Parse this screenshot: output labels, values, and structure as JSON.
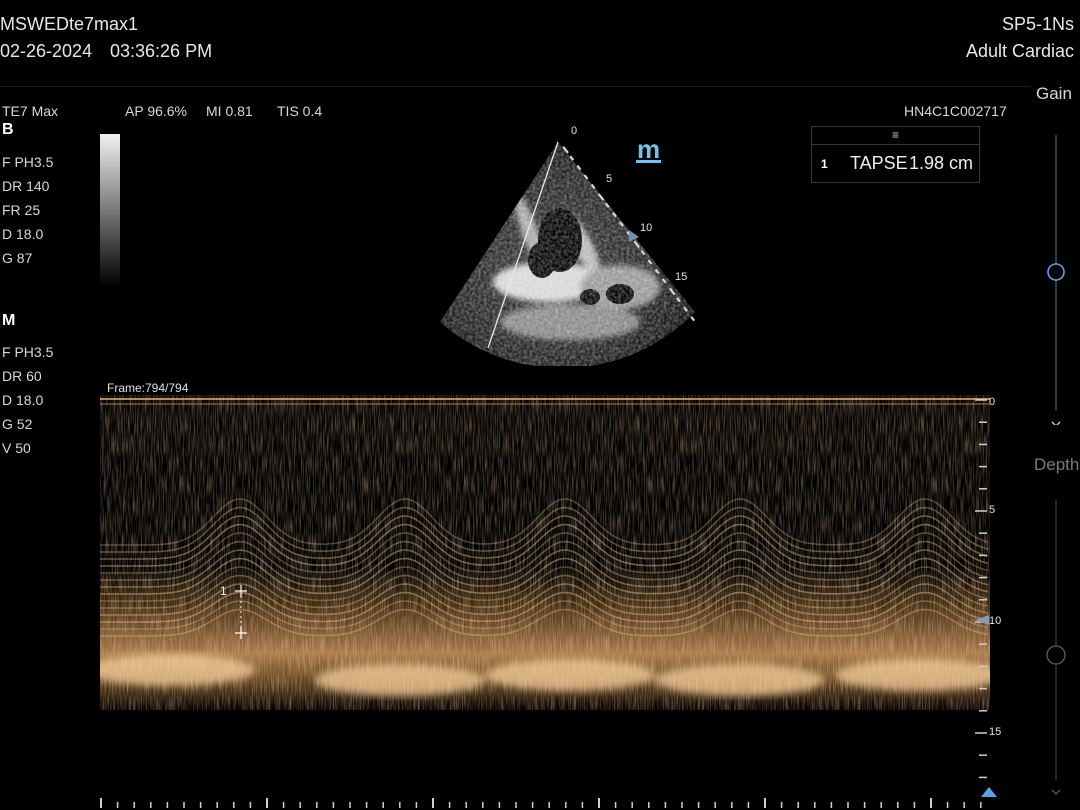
{
  "header": {
    "patient_id": "MSWEDte7max1",
    "date": "02-26-2024",
    "time": "03:36:26 PM",
    "probe": "SP5-1Ns",
    "preset": "Adult Cardiac"
  },
  "info": {
    "system": "TE7 Max",
    "ap": "AP 96.6%",
    "mi": "MI 0.81",
    "tis": "TIS 0.4",
    "serial": "HN4C1C002717"
  },
  "b_mode": {
    "label": "B",
    "params": [
      "F PH3.5",
      "DR 140",
      "FR 25",
      "D 18.0",
      "G 87"
    ],
    "scale_labels": [
      "0",
      "5",
      "10",
      "15"
    ]
  },
  "m_mode": {
    "label": "M",
    "params": [
      "F PH3.5",
      "DR 60",
      "D 18.0",
      "G 52",
      "V 50"
    ],
    "frame": "Frame:794/794",
    "depth_labels": [
      "0",
      "5",
      "10",
      "15"
    ],
    "caliper_label": "1"
  },
  "measurement": {
    "handle_icon": "drag-handle-icon",
    "index": "1",
    "name": "TAPSE",
    "value": "1.98 cm"
  },
  "controls": {
    "gain_label": "Gain",
    "depth_label": "Depth"
  },
  "colors": {
    "background": "#000000",
    "mmode_tint": "#f0b070",
    "accent": "#5aa0e6",
    "mode_icon": "#6fc4e8"
  }
}
